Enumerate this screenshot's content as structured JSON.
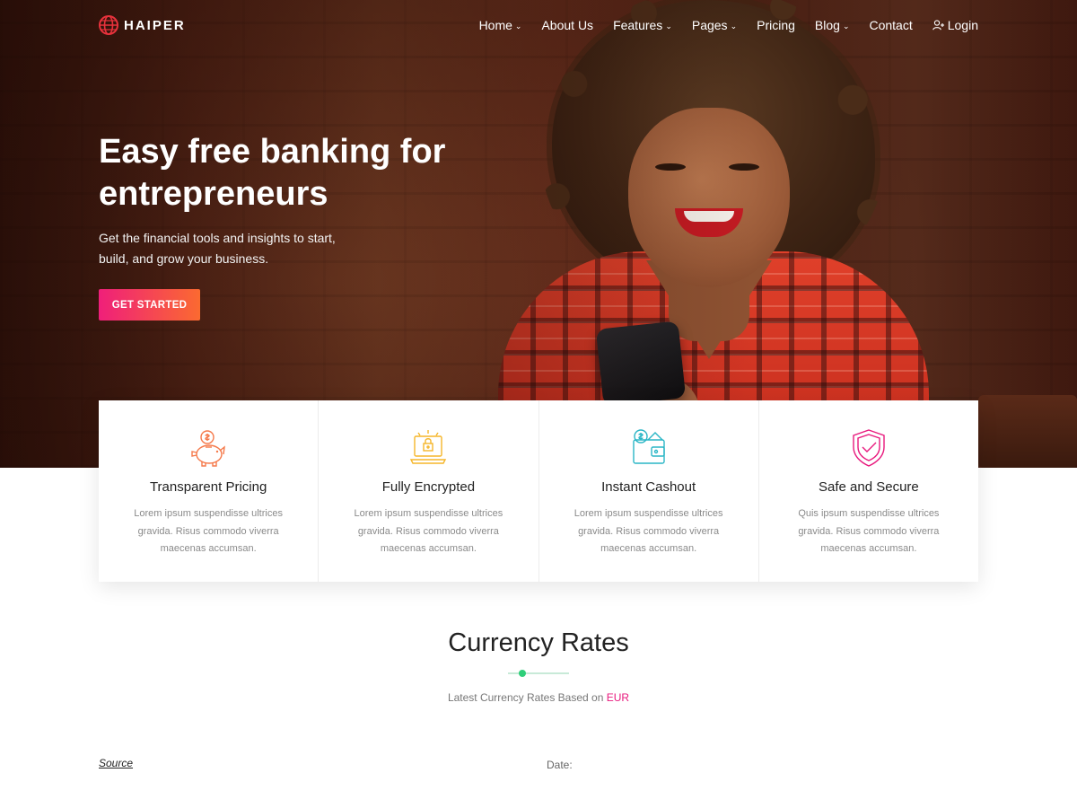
{
  "brand": {
    "name": "HAIPER",
    "accent": "#ef1f7a",
    "accent2": "#fb6a30"
  },
  "nav": {
    "items": [
      {
        "label": "Home",
        "dropdown": true
      },
      {
        "label": "About Us",
        "dropdown": false
      },
      {
        "label": "Features",
        "dropdown": true
      },
      {
        "label": "Pages",
        "dropdown": true
      },
      {
        "label": "Pricing",
        "dropdown": false
      },
      {
        "label": "Blog",
        "dropdown": true
      },
      {
        "label": "Contact",
        "dropdown": false
      }
    ],
    "login_label": "Login"
  },
  "hero": {
    "title_line1": "Easy free banking for",
    "title_line2": "entrepreneurs",
    "subtitle_line1": "Get the financial tools and insights to start,",
    "subtitle_line2": "build, and grow your business.",
    "cta_label": "GET STARTED"
  },
  "features": [
    {
      "icon": "piggy-bank-icon",
      "color": "#f5794a",
      "title": "Transparent Pricing",
      "desc": "Lorem ipsum suspendisse ultrices gravida. Risus commodo viverra maecenas accumsan."
    },
    {
      "icon": "encrypted-laptop-icon",
      "color": "#f5b62a",
      "title": "Fully Encrypted",
      "desc": "Lorem ipsum suspendisse ultrices gravida. Risus commodo viverra maecenas accumsan."
    },
    {
      "icon": "wallet-icon",
      "color": "#2ab6c6",
      "title": "Instant Cashout",
      "desc": "Lorem ipsum suspendisse ultrices gravida. Risus commodo viverra maecenas accumsan."
    },
    {
      "icon": "shield-check-icon",
      "color": "#e8197d",
      "title": "Safe and Secure",
      "desc": "Quis ipsum suspendisse ultrices gravida. Risus commodo viverra maecenas accumsan."
    }
  ],
  "currency": {
    "title": "Currency Rates",
    "subtitle_prefix": "Latest Currency Rates Based on",
    "base": "EUR",
    "source_label": "Source",
    "date_label": "Date:"
  }
}
